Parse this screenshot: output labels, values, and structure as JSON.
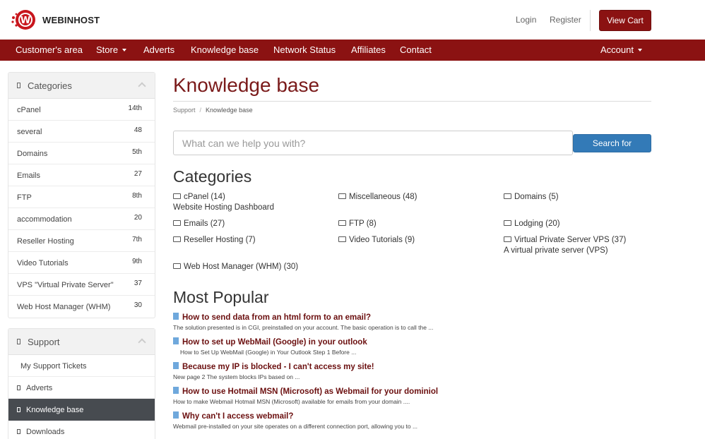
{
  "header": {
    "brand": "WEBINHOST",
    "login": "Login",
    "register": "Register",
    "view_cart": "View Cart"
  },
  "nav": {
    "items": [
      "Customer's area",
      "Store",
      "Adverts",
      "Knowledge base",
      "Network Status",
      "Affiliates",
      "Contact"
    ],
    "account": "Account"
  },
  "sidebar": {
    "categories_title": "Categories",
    "categories": [
      {
        "label": "cPanel",
        "count": "14th"
      },
      {
        "label": "several",
        "count": "48"
      },
      {
        "label": "Domains",
        "count": "5th"
      },
      {
        "label": "Emails",
        "count": "27"
      },
      {
        "label": "FTP",
        "count": "8th"
      },
      {
        "label": "accommodation",
        "count": "20"
      },
      {
        "label": "Reseller Hosting",
        "count": "7th"
      },
      {
        "label": "Video Tutorials",
        "count": "9th"
      },
      {
        "label": "VPS \"Virtual Private Server\"",
        "count": "37"
      },
      {
        "label": "Web Host Manager (WHM)",
        "count": "30"
      }
    ],
    "support_title": "Support",
    "support": [
      {
        "label": "My Support Tickets"
      },
      {
        "label": "Adverts"
      },
      {
        "label": "Knowledge base"
      },
      {
        "label": "Downloads"
      }
    ]
  },
  "main": {
    "title": "Knowledge base",
    "breadcrumb": {
      "home": "Support",
      "current": "Knowledge base"
    },
    "search": {
      "placeholder": "What can we help you with?",
      "button": "Search for"
    },
    "categories_heading": "Categories",
    "categories": [
      {
        "label": "cPanel (14)",
        "desc": "Website Hosting Dashboard"
      },
      {
        "label": "Miscellaneous (48)",
        "desc": ""
      },
      {
        "label": "Domains (5)",
        "desc": ""
      },
      {
        "label": "Emails (27)",
        "desc": ""
      },
      {
        "label": "FTP (8)",
        "desc": ""
      },
      {
        "label": "Lodging (20)",
        "desc": ""
      },
      {
        "label": "Reseller Hosting (7)",
        "desc": ""
      },
      {
        "label": "Video Tutorials (9)",
        "desc": ""
      },
      {
        "label": "Virtual Private Server VPS (37)",
        "desc": "A virtual private server (VPS)"
      },
      {
        "label": "Web Host Manager (WHM) (30)",
        "desc": ""
      }
    ],
    "popular_heading": "Most Popular",
    "articles": [
      {
        "title": "How to send data from an html form to an email?",
        "snippet": "The solution presented is in CGI, preinstalled on your account. The basic operation is to call the ..."
      },
      {
        "title": "How to set up WebMail (Google) in your outlook",
        "snippet": "How to Set Up WebMail (Google) in Your Outlook Step 1 Before ..."
      },
      {
        "title": "Because my IP is blocked - I can't access my site!",
        "snippet": "New page 2 The system blocks IPs based on ..."
      },
      {
        "title": "How to use Hotmail MSN (Microsoft) as Webmail for your dominiol",
        "snippet": "How to make Webmail Hotmail MSN (Microsoft) available for emails from your domain ...."
      },
      {
        "title": "Why can't I access webmail?",
        "snippet": "Webmail pre-installed on your site operates on a different connection port, allowing you to ..."
      }
    ]
  },
  "colors": {
    "brand": "#8b1212",
    "button_primary": "#337ab7",
    "active_nav": "#474b50"
  }
}
